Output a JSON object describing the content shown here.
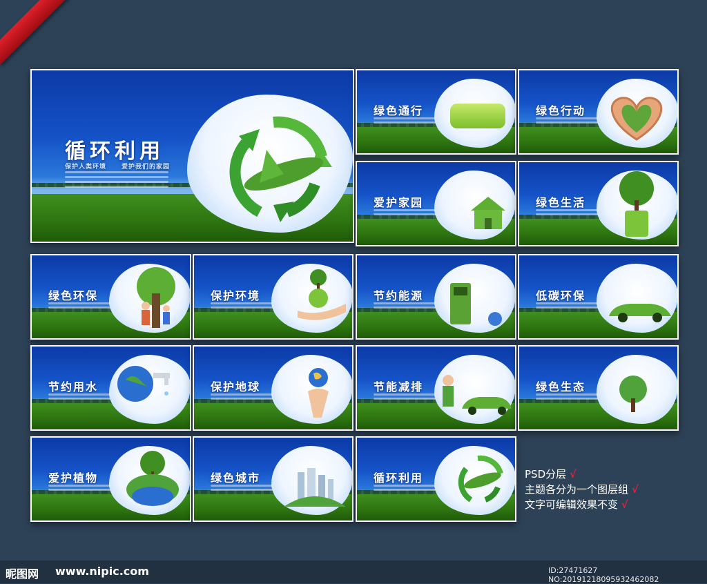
{
  "hero": {
    "title": "循环利用",
    "tagline_1": "保护人类环境",
    "tagline_2": "爱护我们的家园"
  },
  "slides": [
    {
      "id": "lvse-tongxing",
      "title": "绿色通行"
    },
    {
      "id": "lvse-xingdong",
      "title": "绿色行动"
    },
    {
      "id": "aihu-jiayuan",
      "title": "爱护家园"
    },
    {
      "id": "lvse-shenghuo",
      "title": "绿色生活"
    },
    {
      "id": "lvse-huanbao",
      "title": "绿色环保"
    },
    {
      "id": "baohu-huanjing",
      "title": "保护环境"
    },
    {
      "id": "jieyue-nengyuan",
      "title": "节约能源"
    },
    {
      "id": "ditan-huanbao",
      "title": "低碳环保"
    },
    {
      "id": "jieyue-yongshui",
      "title": "节约用水"
    },
    {
      "id": "baohu-diqiu",
      "title": "保护地球"
    },
    {
      "id": "jieneng-jianpai",
      "title": "节能减排"
    },
    {
      "id": "lvse-shengtai",
      "title": "绿色生态"
    },
    {
      "id": "aihu-zhiwu",
      "title": "爱护植物"
    },
    {
      "id": "lvse-chengshi",
      "title": "绿色城市"
    },
    {
      "id": "xunhuan-liyong",
      "title": "循环利用"
    }
  ],
  "features": [
    {
      "text": "PSD分层",
      "mark": "√"
    },
    {
      "text": "主题各分为一个图层组",
      "mark": "√"
    },
    {
      "text": "文字可编辑效果不变",
      "mark": "√"
    }
  ],
  "watermark": {
    "logo": "昵图网",
    "url": "www.nipic.com",
    "id": "ID:27471627 NO:20191218095932462082"
  },
  "colors": {
    "background": "#2e4257",
    "ribbon": "#d01c25",
    "sky": "#1553c8",
    "grass": "#2d7410",
    "check": "#e0223b"
  }
}
